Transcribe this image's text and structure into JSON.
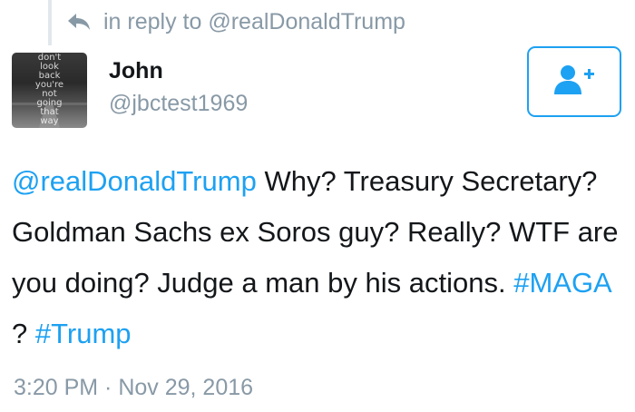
{
  "reply_context": {
    "prefix": "in reply to",
    "handle": "@realDonaldTrump"
  },
  "author": {
    "display_name": "John",
    "screen_name": "@jbctest1969",
    "avatar_text": [
      "don't",
      "look",
      "back",
      "you're",
      "not",
      "going",
      "that",
      "way"
    ]
  },
  "follow_button": {
    "icon": "follow-user-plus-icon"
  },
  "tweet": {
    "mention": "@realDonaldTrump",
    "text_part1": "Why? Treasury Secretary? Goldman Sachs ex Soros guy? Really? WTF are you doing? Judge a man by his actions.",
    "hashtag1": "#MAGA",
    "text_part2": "?",
    "hashtag2": "#Trump"
  },
  "timestamp": "3:20 PM · Nov 29, 2016",
  "colors": {
    "link": "#1da1f2",
    "muted": "#8899a6",
    "text": "#14171a"
  }
}
